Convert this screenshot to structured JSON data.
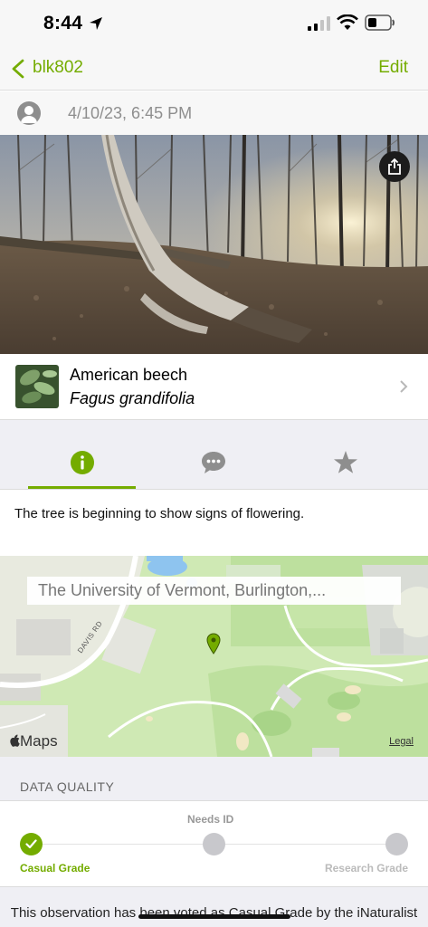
{
  "status_bar": {
    "time": "8:44"
  },
  "nav": {
    "back_label": "blk802",
    "edit_label": "Edit"
  },
  "observation": {
    "date": "4/10/23, 6:45 PM"
  },
  "taxon": {
    "common_name": "American beech",
    "scientific_name": "Fagus grandifolia"
  },
  "tabs": [
    {
      "name": "info",
      "icon": "info-icon",
      "selected": true
    },
    {
      "name": "comments",
      "icon": "speech-bubble-icon",
      "selected": false
    },
    {
      "name": "favorites",
      "icon": "star-icon",
      "selected": false
    }
  ],
  "description": "The tree is beginning to show signs of flowering.",
  "map": {
    "place": "The University of Vermont, Burlington,...",
    "street": "DAVIS RD",
    "provider": "Maps",
    "legal": "Legal"
  },
  "data_quality": {
    "header": "DATA QUALITY",
    "casual_label": "Casual Grade",
    "needs_id_label": "Needs ID",
    "research_label": "Research Grade",
    "note": "This observation has been voted as Casual Grade by the iNaturalist community."
  },
  "colors": {
    "accent": "#74ac00",
    "bar_background": "#f7f7f7",
    "section_background": "#efeff4",
    "inactive_icon": "#8e8e8e"
  }
}
